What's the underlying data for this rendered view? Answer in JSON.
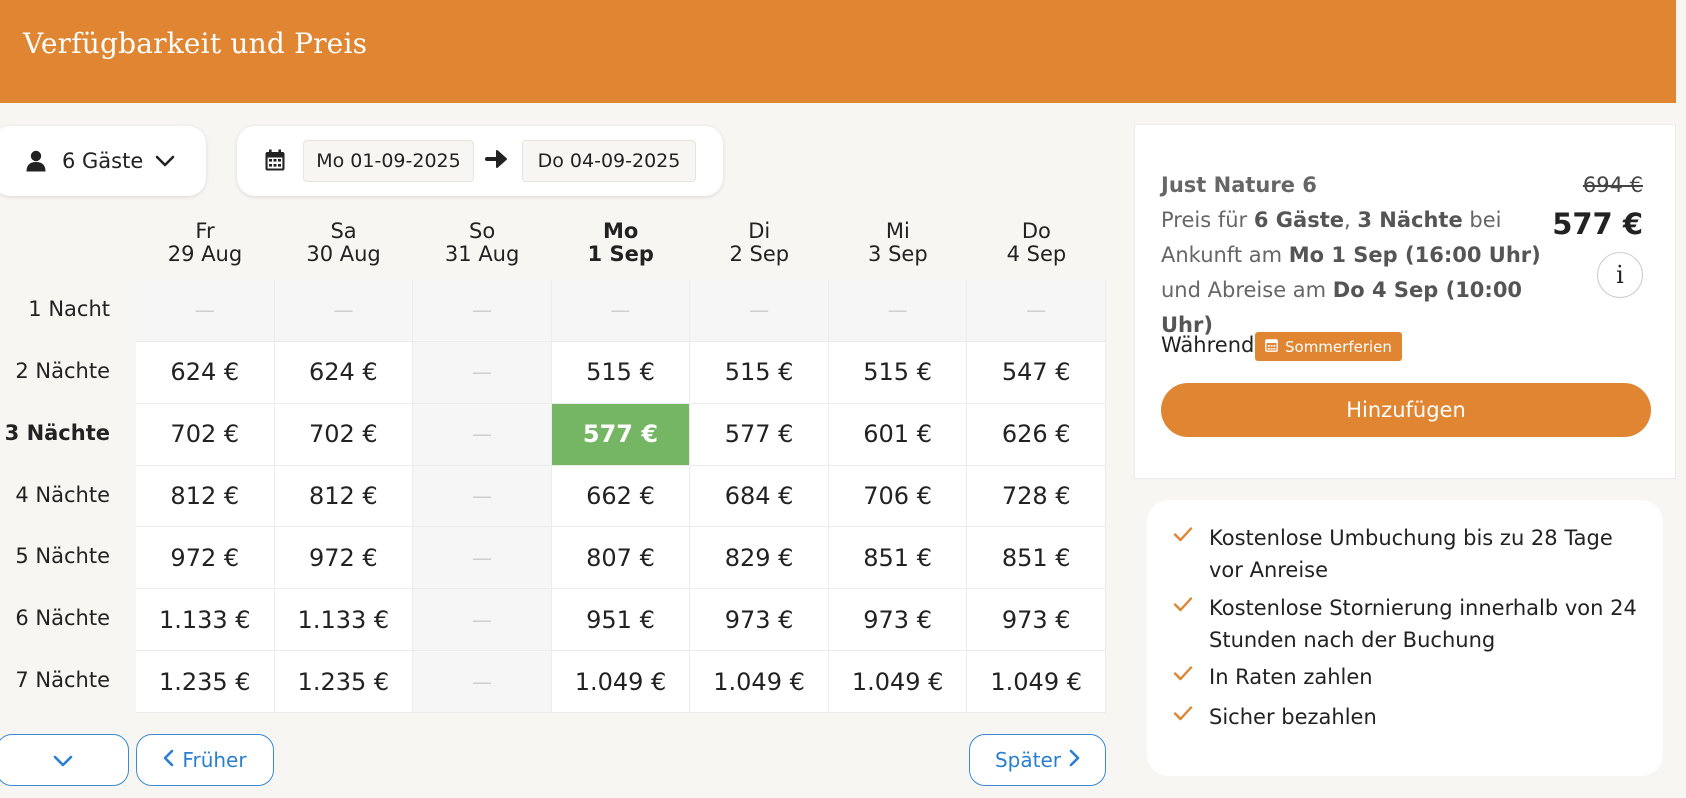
{
  "header": {
    "title": "Verfügbarkeit und Preis"
  },
  "search": {
    "guests_label": "6 Gäste",
    "arrival_date": "Mo 01-09-2025",
    "departure_date": "Do 04-09-2025"
  },
  "days": [
    {
      "weekday": "Fr",
      "date": "29 Aug"
    },
    {
      "weekday": "Sa",
      "date": "30 Aug"
    },
    {
      "weekday": "So",
      "date": "31 Aug"
    },
    {
      "weekday": "Mo",
      "date": "1 Sep"
    },
    {
      "weekday": "Di",
      "date": "2 Sep"
    },
    {
      "weekday": "Mi",
      "date": "3 Sep"
    },
    {
      "weekday": "Do",
      "date": "4 Sep"
    }
  ],
  "selected_day_index": 3,
  "selected_row_index": 2,
  "rows": [
    {
      "label": "1 Nacht",
      "prices": [
        "—",
        "—",
        "—",
        "—",
        "—",
        "—",
        "—"
      ]
    },
    {
      "label": "2 Nächte",
      "prices": [
        "624 €",
        "624 €",
        "—",
        "515 €",
        "515 €",
        "515 €",
        "547 €"
      ]
    },
    {
      "label": "3 Nächte",
      "prices": [
        "702 €",
        "702 €",
        "—",
        "577 €",
        "577 €",
        "601 €",
        "626 €"
      ]
    },
    {
      "label": "4 Nächte",
      "prices": [
        "812 €",
        "812 €",
        "—",
        "662 €",
        "684 €",
        "706 €",
        "728 €"
      ]
    },
    {
      "label": "5 Nächte",
      "prices": [
        "972 €",
        "972 €",
        "—",
        "807 €",
        "829 €",
        "851 €",
        "851 €"
      ]
    },
    {
      "label": "6 Nächte",
      "prices": [
        "1.133 €",
        "1.133 €",
        "—",
        "951 €",
        "973 €",
        "973 €",
        "973 €"
      ]
    },
    {
      "label": "7 Nächte",
      "prices": [
        "1.235 €",
        "1.235 €",
        "—",
        "1.049 €",
        "1.049 €",
        "1.049 €",
        "1.049 €"
      ]
    }
  ],
  "nav": {
    "earlier": "Früher",
    "later": "Später"
  },
  "summary": {
    "name": "Just Nature 6",
    "old_price": "694 €",
    "price": "577 €",
    "info_label": "i",
    "desc_prefix": "Preis für ",
    "guests": "6 Gäste",
    "sep": ", ",
    "nights": "3 Nächte",
    "arrival_text": " bei Ankunft am ",
    "arrival": "Mo 1 Sep (16:00 Uhr)",
    "departure_text": " und Abreise am ",
    "departure": "Do 4 Sep (10:00 Uhr)",
    "during_label": "Während",
    "season_badge": "Sommerferien",
    "add_button": "Hinzufügen"
  },
  "features": [
    "Kostenlose Umbuchung bis zu 28 Tage vor Anreise",
    "Kostenlose Stornierung innerhalb von 24 Stunden nach der Buchung",
    "In Raten zahlen",
    "Sicher bezahlen"
  ],
  "colors": {
    "brand_orange": "#e08532",
    "selected_green": "#74b663",
    "link_blue": "#2a7fcf"
  },
  "icons": {
    "guests": "person-icon",
    "guests_dropdown": "chevron-down-icon",
    "calendar": "calendar-icon",
    "date_range": "arrow-right-icon",
    "earlier": "chevron-left-icon",
    "later": "chevron-right-icon",
    "feature": "check-icon",
    "badge": "calendar-icon"
  }
}
